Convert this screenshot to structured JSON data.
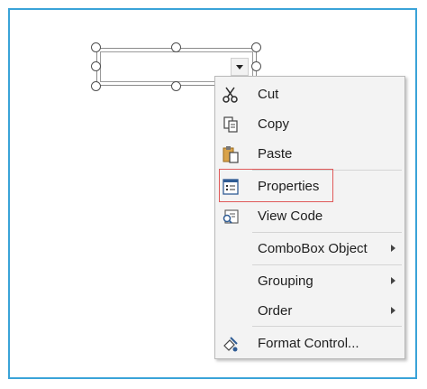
{
  "combobox": {
    "dropdown_icon": "chevron-down-icon"
  },
  "menu": {
    "items": [
      {
        "label": "Cut",
        "icon": "scissors-icon"
      },
      {
        "label": "Copy",
        "icon": "copy-icon"
      },
      {
        "label": "Paste",
        "icon": "paste-icon"
      },
      {
        "label": "Properties",
        "icon": "properties-icon"
      },
      {
        "label": "View Code",
        "icon": "view-code-icon"
      },
      {
        "label": "ComboBox Object",
        "icon": ""
      },
      {
        "label": "Grouping",
        "icon": ""
      },
      {
        "label": "Order",
        "icon": ""
      },
      {
        "label": "Format Control...",
        "icon": "format-control-icon"
      }
    ]
  },
  "colors": {
    "frame": "#3aa3d8",
    "highlight": "#e05a5a",
    "menu_bg": "#f3f3f3"
  }
}
